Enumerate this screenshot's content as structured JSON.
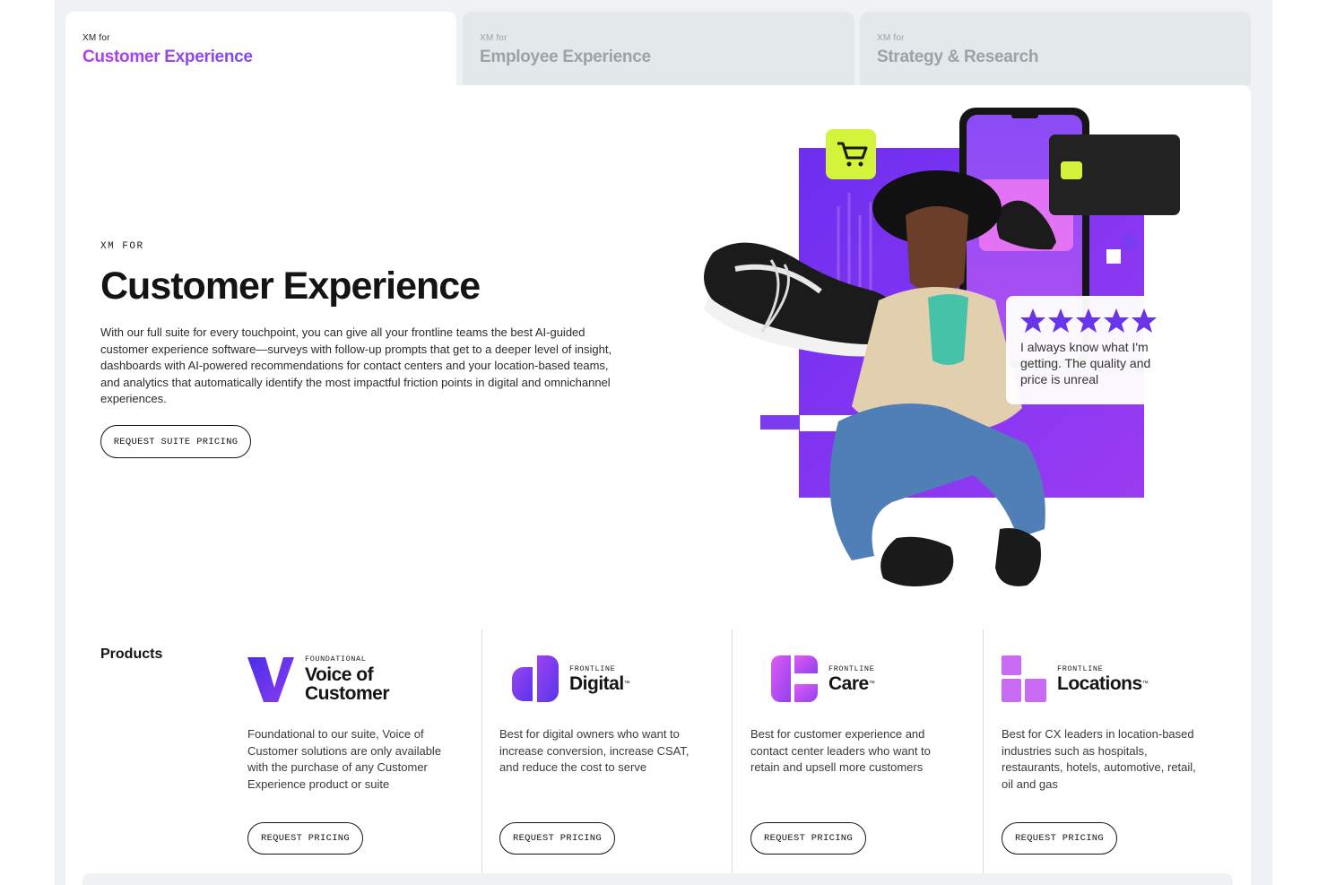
{
  "tabs": [
    {
      "prefix": "XM for",
      "label": "Customer Experience",
      "active": true
    },
    {
      "prefix": "XM for",
      "label": "Employee Experience",
      "active": false
    },
    {
      "prefix": "XM for",
      "label": "Strategy & Research",
      "active": false
    }
  ],
  "hero": {
    "eyebrow": "XM FOR",
    "title": "Customer Experience",
    "body": "With our full suite for every touchpoint, you can give all your frontline teams the best AI-guided customer experience software—surveys with follow-up prompts that get to a deeper level of insight, dashboards with AI-powered recommendations for contact centers and your location-based teams, and analytics that automatically identify the most impactful friction points in digital and omnichannel experiences.",
    "cta": "REQUEST SUITE PRICING"
  },
  "review": {
    "rating": 5,
    "text": "I always know what I'm getting. The quality and price is unreal"
  },
  "products": {
    "label": "Products",
    "items": [
      {
        "kicker": "FOUNDATIONAL",
        "name": "Voice of Customer",
        "name_line1": "Voice of",
        "name_line2": "Customer",
        "desc": "Foundational to our suite, Voice of Customer solutions are only available with the purchase of any Customer Experience product or suite",
        "cta": "REQUEST PRICING"
      },
      {
        "kicker": "FRONTLINE",
        "name": "Digital",
        "tm": "™",
        "desc": "Best for digital owners who want to increase conversion, increase CSAT, and reduce the cost to serve",
        "cta": "REQUEST PRICING"
      },
      {
        "kicker": "FRONTLINE",
        "name": "Care",
        "tm": "™",
        "desc": "Best for customer experience and contact center leaders who want to retain and upsell more customers",
        "cta": "REQUEST PRICING"
      },
      {
        "kicker": "FRONTLINE",
        "name": "Locations",
        "tm": "™",
        "desc": "Best for CX leaders in location-based industries such as hospitals, restaurants, hotels, automotive, retail, oil and gas",
        "cta": "REQUEST PRICING"
      }
    ]
  },
  "colors": {
    "accent_purple": "#7b3cf0",
    "accent_violet": "#a24af2",
    "lime": "#d2f53c",
    "star": "#6a35e8"
  }
}
